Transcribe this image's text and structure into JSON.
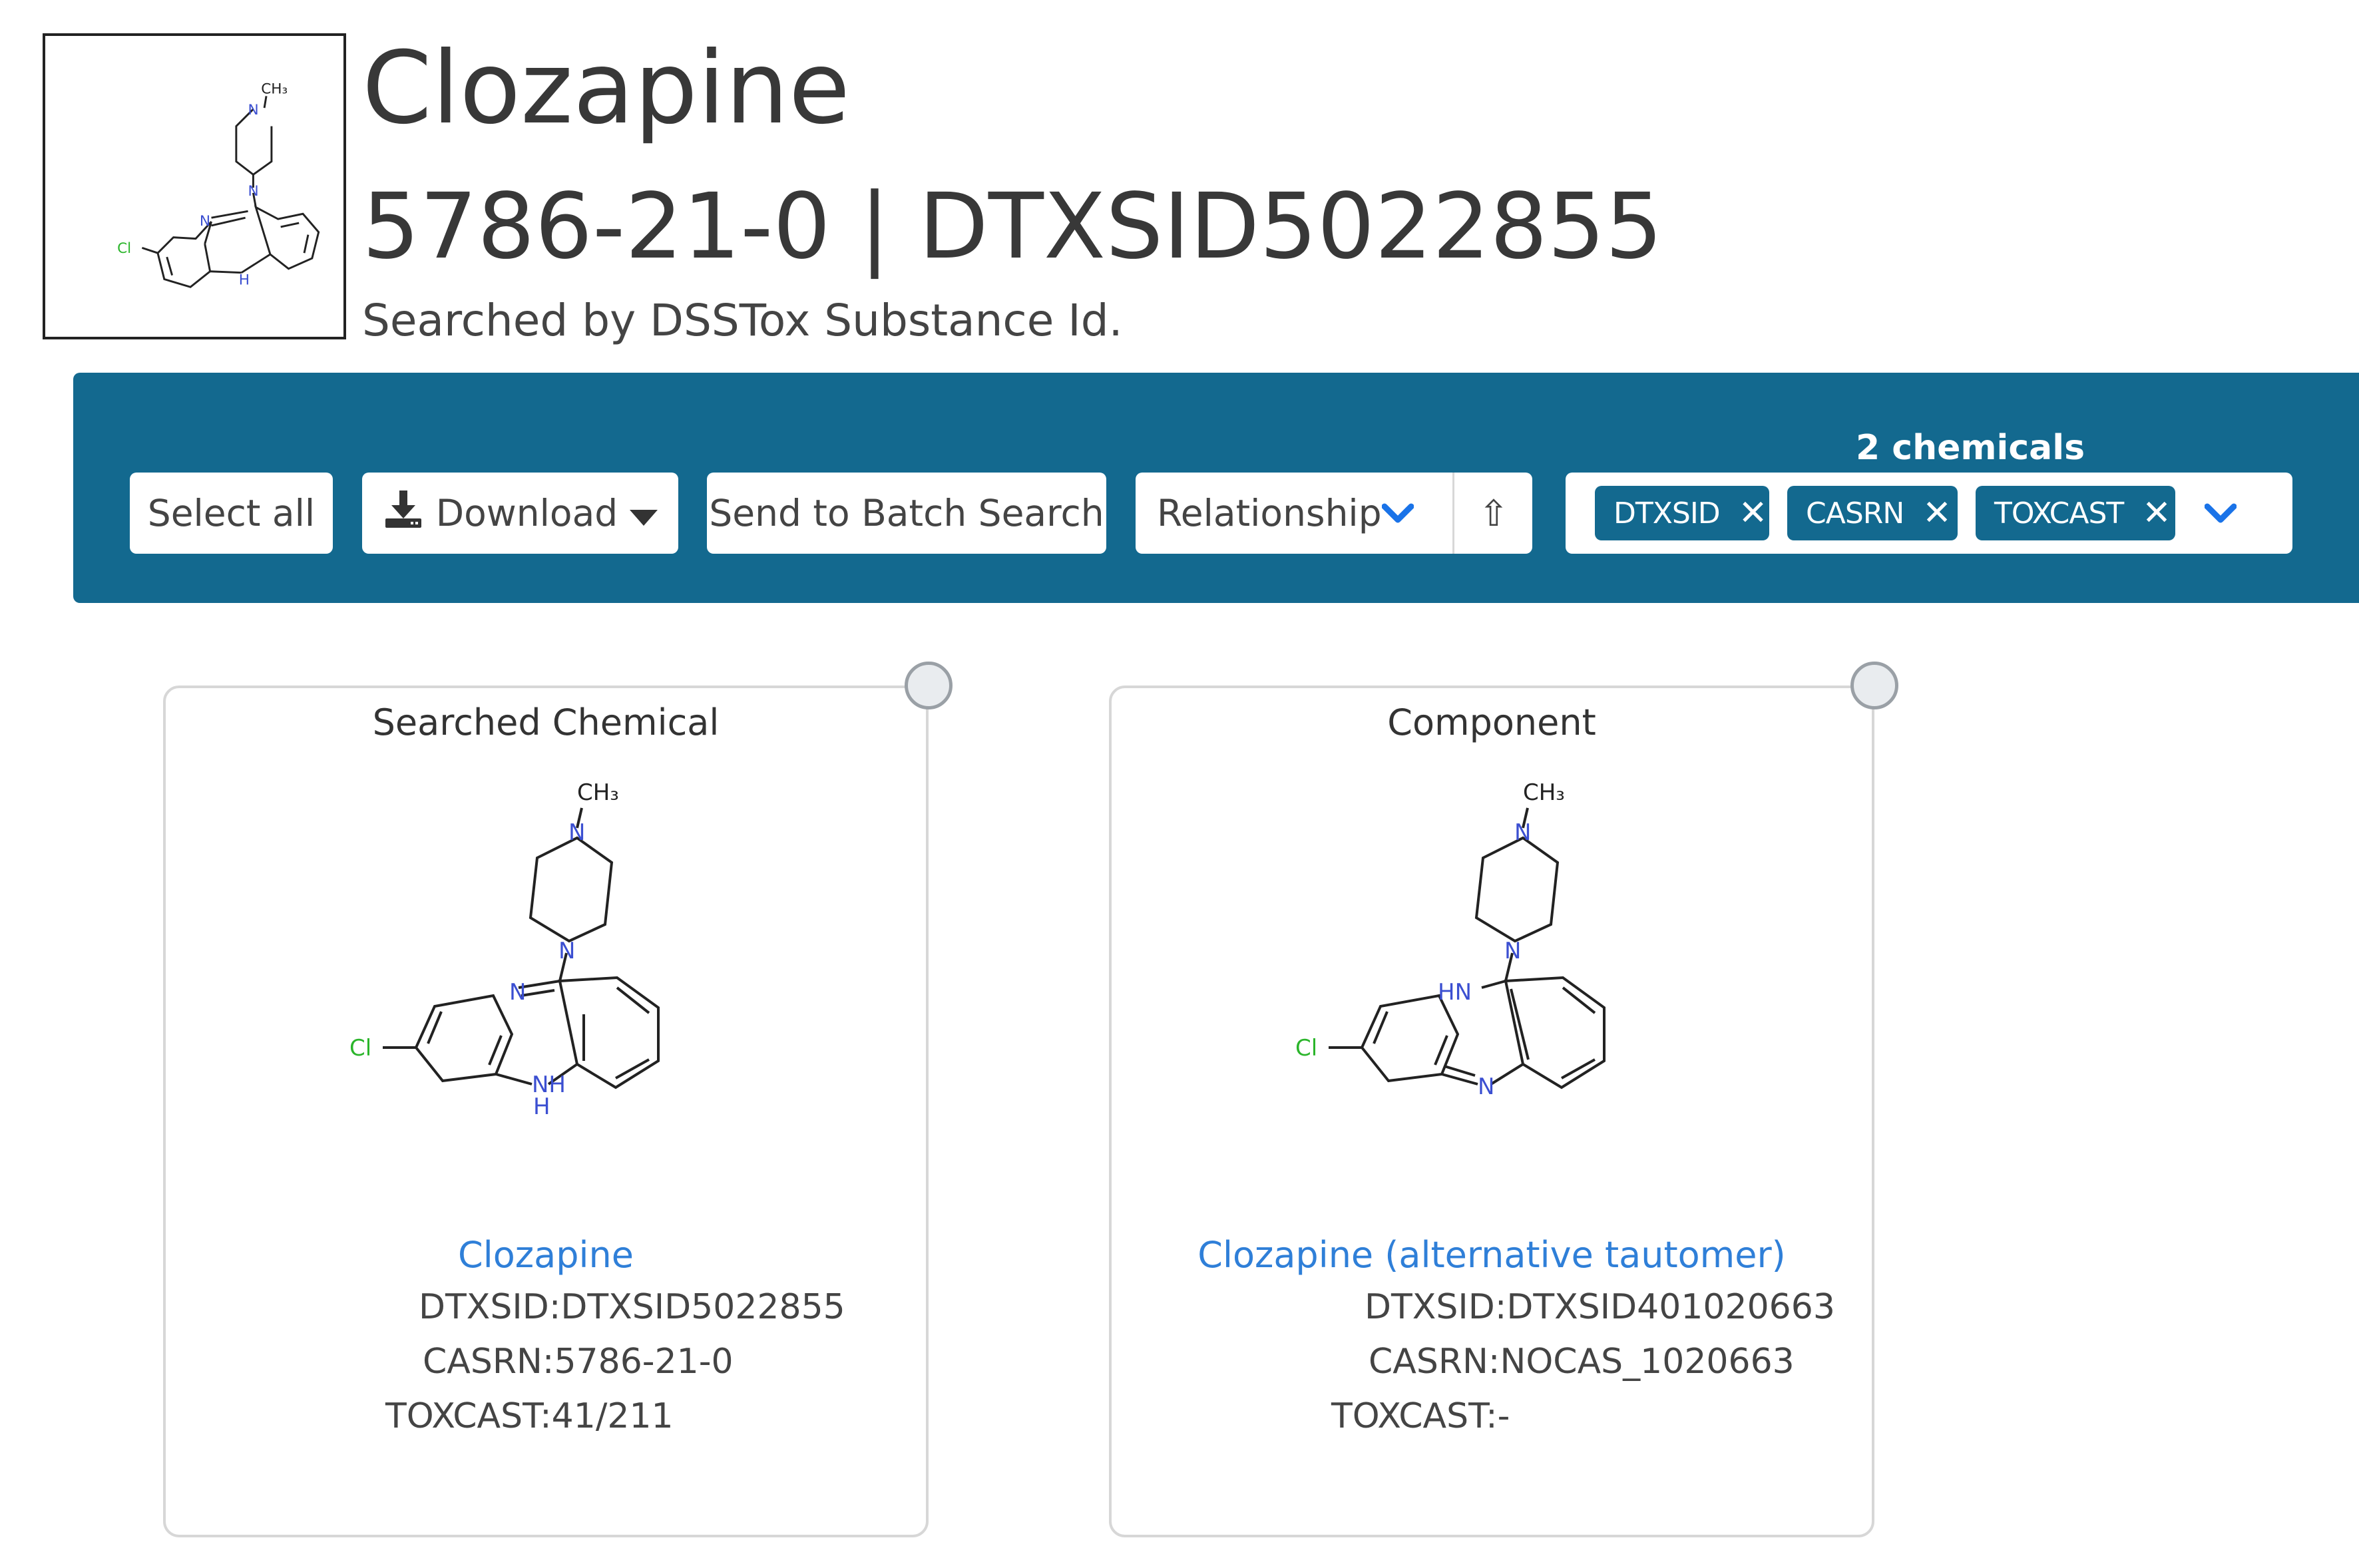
{
  "header": {
    "title": "Clozapine",
    "subtitle": "5786-21-0 | DTXSID5022855",
    "searched_by": "Searched by DSSTox Substance Id."
  },
  "toolbar": {
    "select_all_label": "Select all",
    "download_label": "Download",
    "batch_label": "Send to Batch Search",
    "relationship_label": "Relationship",
    "sort_glyph": "⇧",
    "chem_count": "2 chemicals",
    "tags": [
      "DTXSID",
      "CASRN",
      "TOXCAST"
    ],
    "tag_remove_glyph": "✕"
  },
  "cards": [
    {
      "header": "Searched Chemical",
      "name": "Clozapine",
      "dtxsid": "DTXSID:DTXSID5022855",
      "casrn": "CASRN:5786-21-0",
      "toxcast": "TOXCAST:41/211",
      "atoms": {
        "ch3": "CH₃",
        "n1": "N",
        "n2": "N",
        "n3": "N",
        "nh": "NH",
        "h": "H",
        "cl": "Cl"
      }
    },
    {
      "header": "Component",
      "name": "Clozapine (alternative tautomer)",
      "dtxsid": "DTXSID:DTXSID401020663",
      "casrn": "CASRN:NOCAS_1020663",
      "toxcast": "TOXCAST:-",
      "atoms": {
        "ch3": "CH₃",
        "n1": "N",
        "n2": "N",
        "hn": "HN",
        "n3": "N",
        "cl": "Cl"
      }
    }
  ],
  "colors": {
    "toolbar_bg": "#13698f",
    "link": "#2f7fd8",
    "nitrogen": "#3b4fd1",
    "chlorine": "#2bb52b",
    "chevron": "#1a73e8"
  }
}
